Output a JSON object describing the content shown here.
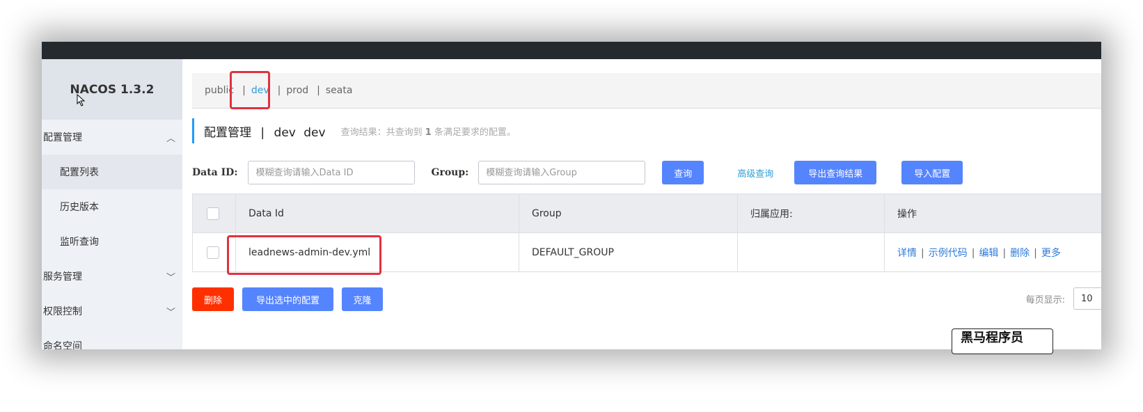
{
  "app": {
    "title": "NACOS 1.3.2"
  },
  "sidebar": {
    "groups": [
      {
        "label": "配置管理",
        "expanded": true,
        "items": [
          "配置列表",
          "历史版本",
          "监听查询"
        ]
      },
      {
        "label": "服务管理",
        "expanded": false
      },
      {
        "label": "权限控制",
        "expanded": false
      },
      {
        "label": "命名空间",
        "expanded": false
      }
    ]
  },
  "namespaces": {
    "separator": "|",
    "items": [
      "public",
      "dev",
      "prod",
      "seata"
    ],
    "active": "dev"
  },
  "header": {
    "title": "配置管理",
    "separator": "|",
    "namespace_id": "dev",
    "namespace_name": "dev",
    "result_prefix": "查询结果：共查询到",
    "result_count": "1",
    "result_suffix": "条满足要求的配置。"
  },
  "search": {
    "data_id_label": "Data ID:",
    "data_id_placeholder": "模糊查询请输入Data ID",
    "group_label": "Group:",
    "group_placeholder": "模糊查询请输入Group",
    "query_button": "查询",
    "advanced_link": "高级查询",
    "export_results_button": "导出查询结果",
    "import_button": "导入配置"
  },
  "table": {
    "columns": [
      "Data Id",
      "Group",
      "归属应用:",
      "操作"
    ],
    "rows": [
      {
        "data_id": "leadnews-admin-dev.yml",
        "group": "DEFAULT_GROUP",
        "app": "",
        "actions": [
          "详情",
          "示例代码",
          "编辑",
          "删除",
          "更多"
        ]
      }
    ]
  },
  "bulk": {
    "delete_button": "删除",
    "export_selected_button": "导出选中的配置",
    "clone_button": "克隆"
  },
  "pagination": {
    "page_size_label": "每页显示:",
    "page_size": "10"
  },
  "watermark": {
    "text": "黑马程序员"
  },
  "colors": {
    "topbar": "#252a2f",
    "sidebar_bg": "#eef1f6",
    "primary_button": "#5584ff",
    "danger_button": "#ff3000",
    "link": "#2d9ed8",
    "highlight_box": "#e0313e"
  }
}
